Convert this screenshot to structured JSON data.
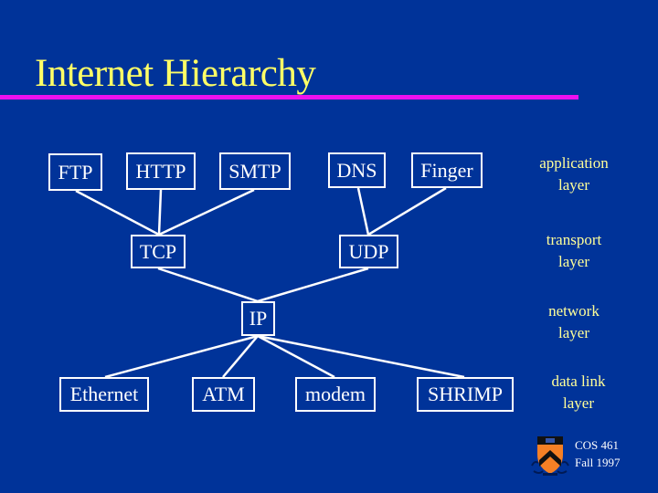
{
  "slide": {
    "title": "Internet Hierarchy",
    "colors": {
      "background": "#003399",
      "title": "#ffff66",
      "title_rule": "#ee11ee",
      "box_border": "#ffffff",
      "box_text": "#ffffff",
      "layer_label": "#ffff99"
    }
  },
  "diagram": {
    "nodes": {
      "ftp": "FTP",
      "http": "HTTP",
      "smtp": "SMTP",
      "dns": "DNS",
      "finger": "Finger",
      "tcp": "TCP",
      "udp": "UDP",
      "ip": "IP",
      "ethernet": "Ethernet",
      "atm": "ATM",
      "modem": "modem",
      "shrimp": "SHRIMP"
    },
    "edges": [
      [
        "ftp",
        "tcp"
      ],
      [
        "http",
        "tcp"
      ],
      [
        "smtp",
        "tcp"
      ],
      [
        "dns",
        "udp"
      ],
      [
        "finger",
        "udp"
      ],
      [
        "tcp",
        "ip"
      ],
      [
        "udp",
        "ip"
      ],
      [
        "ip",
        "ethernet"
      ],
      [
        "ip",
        "atm"
      ],
      [
        "ip",
        "modem"
      ],
      [
        "ip",
        "shrimp"
      ]
    ]
  },
  "layers": {
    "application": [
      "application",
      "layer"
    ],
    "transport": [
      "transport",
      "layer"
    ],
    "network": [
      "network",
      "layer"
    ],
    "datalink": [
      "data link",
      "layer"
    ]
  },
  "footer": {
    "logo": "princeton-shield-icon",
    "course": "COS 461",
    "term": "Fall 1997"
  }
}
